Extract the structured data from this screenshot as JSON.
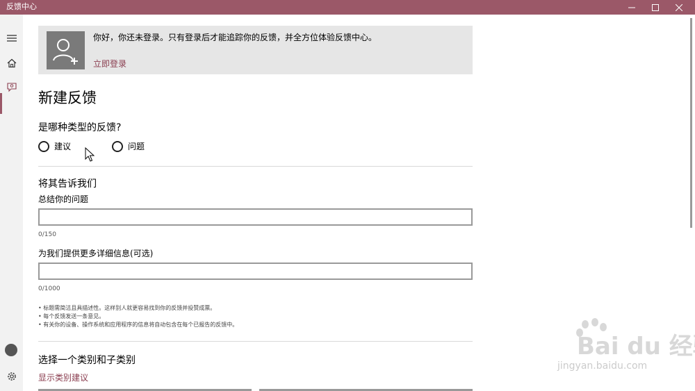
{
  "window": {
    "title": "反馈中心"
  },
  "banner": {
    "message": "你好，你还未登录。只有登录后才能追踪你的反馈，并全方位体验反馈中心。",
    "login_link": "立即登录"
  },
  "page": {
    "title": "新建反馈",
    "type_question": "是哪种类型的反馈?",
    "type_options": [
      "建议",
      "问题"
    ],
    "tell_us_title": "将其告诉我们",
    "summary_label": "总结你的问题",
    "summary_value": "",
    "summary_counter": "0/150",
    "details_label": "为我们提供更多详细信息(可选)",
    "details_value": "",
    "details_counter": "0/1000",
    "tips": [
      "• 标题需简洁且具描述性。这样别人就更容易找到你的反馈并投赞成票。",
      "• 每个反馈发送一条意见。",
      "• 有关你的设备、操作系统和应用程序的信息将自动包含在每个已报告的反馈中。"
    ],
    "category_title": "选择一个类别和子类别",
    "category_link": "显示类别建议"
  },
  "watermark": {
    "brand": "Bai du 经验",
    "url": "jingyan.baidu.com"
  },
  "colors": {
    "accent": "#9b5868",
    "link": "#8a3d4f",
    "banner_bg": "#e6e6e6"
  },
  "icons": {
    "nav": [
      "hamburger-icon",
      "home-icon",
      "feedback-icon",
      "gear-icon"
    ],
    "window": [
      "minimize-icon",
      "maximize-icon",
      "close-icon"
    ]
  }
}
